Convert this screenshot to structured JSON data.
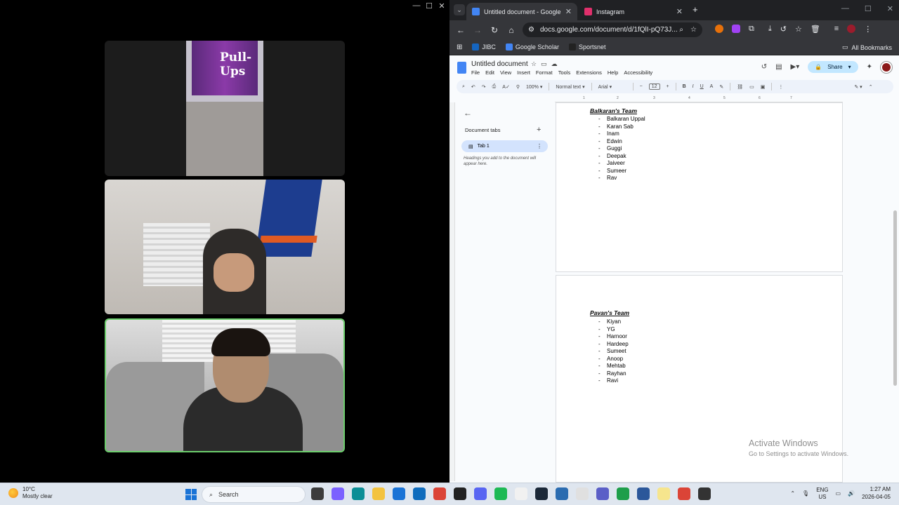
{
  "call": {
    "controls": [
      "—",
      "☐",
      "✕"
    ],
    "feed1_brand": "Pull-Ups"
  },
  "browser": {
    "tabs": [
      {
        "title": "Untitled document - Google Docs",
        "icon_color": "#4285f4"
      },
      {
        "title": "Instagram",
        "icon_color": "#e1306c"
      }
    ],
    "new_tab": "+",
    "window_controls": [
      "—",
      "☐",
      "✕"
    ],
    "url": "docs.google.com/document/d/1fQlI-pQ73J...",
    "bookmarks": [
      {
        "label": "JIBC",
        "icon_color": "#1565c0"
      },
      {
        "label": "Google Scholar",
        "icon_color": "#4285f4"
      },
      {
        "label": "Sportsnet",
        "icon_color": "#222222"
      }
    ],
    "all_bookmarks": "All Bookmarks"
  },
  "docs": {
    "title": "Untitled document",
    "menu": [
      "File",
      "Edit",
      "View",
      "Insert",
      "Format",
      "Tools",
      "Extensions",
      "Help",
      "Accessibility"
    ],
    "share_label": "Share",
    "toolbar": {
      "zoom": "100%",
      "style": "Normal text",
      "font": "Arial",
      "font_size": "12"
    },
    "ruler_numbers": [
      "1",
      "2",
      "3",
      "4",
      "5",
      "6",
      "7"
    ],
    "outline": {
      "doc_tabs_label": "Document tabs",
      "tab1_label": "Tab 1",
      "hint": "Headings you add to the document will appear here."
    },
    "teams": [
      {
        "title": "Balkaran's Team",
        "members": [
          "Balkaran Uppal",
          "Karan Sab",
          "Inam",
          "Edwin",
          "Guggi",
          "Deepak",
          "Jaiveer",
          "Sumeer",
          "Rav"
        ]
      },
      {
        "title": "Pavan's Team",
        "members": [
          "Kiyan",
          "YG",
          "Harnoor",
          "Hardeep",
          "Sumeet",
          "Anoop",
          "Mehtab",
          "Rayhan",
          "Ravi"
        ]
      }
    ],
    "watermark": {
      "title": "Activate Windows",
      "subtitle": "Go to Settings to activate Windows."
    }
  },
  "taskbar": {
    "temperature": "10°C",
    "condition": "Mostly clear",
    "search_placeholder": "Search",
    "lang_1": "ENG",
    "lang_2": "US",
    "time": "1:27 AM",
    "date": "2026-04-05",
    "pinned": [
      {
        "name": "task-view",
        "color": "#3c3c3c"
      },
      {
        "name": "copilot",
        "color": "#7b61ff"
      },
      {
        "name": "edge",
        "color": "#0c8e96"
      },
      {
        "name": "file-explorer",
        "color": "#f3c340"
      },
      {
        "name": "mail",
        "color": "#1a73d6"
      },
      {
        "name": "outlook",
        "color": "#0f6cbd"
      },
      {
        "name": "chrome",
        "color": "#db4437"
      },
      {
        "name": "epic",
        "color": "#222222"
      },
      {
        "name": "discord",
        "color": "#5865f2"
      },
      {
        "name": "spotify",
        "color": "#1db954"
      },
      {
        "name": "notepad",
        "color": "#f1f1f1"
      },
      {
        "name": "steam",
        "color": "#1b2838"
      },
      {
        "name": "app-blue",
        "color": "#2b6cb0"
      },
      {
        "name": "itunes",
        "color": "#e0e0e0"
      },
      {
        "name": "teams",
        "color": "#5b5fc7"
      },
      {
        "name": "app-green",
        "color": "#1e9e4a"
      },
      {
        "name": "word",
        "color": "#2b579a"
      },
      {
        "name": "notes",
        "color": "#f6e58d"
      },
      {
        "name": "chrome-2",
        "color": "#db4437"
      },
      {
        "name": "app-dark",
        "color": "#333333"
      }
    ]
  }
}
